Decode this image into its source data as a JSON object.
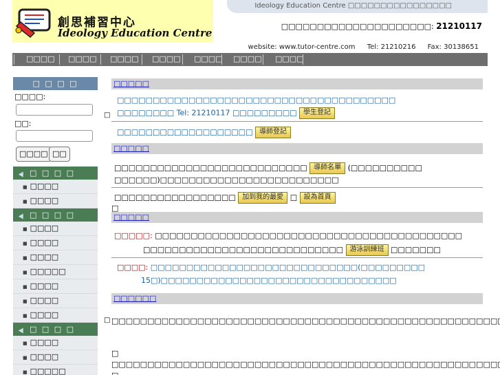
{
  "header": {
    "logo_cn": "創思補習中心",
    "logo_en": "Ideology Education Centre",
    "top_bar": "Ideology Education Centre □□□□□□□□□□□□□□□□",
    "enquiry_label": "□□□□□□□□□□□□□□□□□□□□□:",
    "enquiry_phone": "21210117",
    "website": "website: www.tutor-centre.com",
    "tel": "Tel: 21210216",
    "fax": "Fax: 30138651"
  },
  "nav": {
    "items": [
      "□□□□",
      "□□□□",
      "□□□□",
      "□□□□",
      "□□□□",
      "□□□□",
      "□□□□"
    ]
  },
  "sidebar": {
    "login_title": "□ □ □ □",
    "username_label": "□□□□:",
    "password_label": "□□:",
    "login_button": "□□□□",
    "other_button": "□□",
    "sections": [
      {
        "title": "□ □ □ □",
        "items": [
          "□□□□",
          "□□□□"
        ]
      },
      {
        "title": "□ □ □ □",
        "items": [
          "□□□□",
          "□□□□",
          "□□□□",
          "□□□□□",
          "□□□□",
          "□□□□",
          "□□□□"
        ]
      },
      {
        "title": "□ □ □ □",
        "items": [
          "□□□□",
          "□□□□",
          "□□□□□"
        ]
      }
    ]
  },
  "main": {
    "section1_title": "□□□□□",
    "section1_line1": "□□□□□□□□□□□□□□□□□□□□□□□□□□□□□□□□□□□□□□□",
    "section1_line2": "□□□□□□□□ Tel: 21210117  □□□□□□□□□",
    "btn_student": "學生登記",
    "section1_line3": "□□□□□□□□□□□□□□□□□□□",
    "btn_tutor": "導師登記",
    "section2_title": "□□□□□",
    "section2_line1": "□□□□□□□□□□□□□□□□□□□□□□□□□□□",
    "btn_tutor_list": "導師名單",
    "section2_line1b": "(□□□□□□□□□□",
    "section2_line2": "□□□□□□)□□□□□□□□□□□□□□□□□□□□□□□□□",
    "section2_line3": "□□□□□□□□□□□□□□□□□",
    "btn_favorite": "加到我的最愛",
    "btn_homepage": "設為首頁",
    "section3_title": "□□□□□",
    "section3_label1": "□□□□□:",
    "section3_line1": "□□□□□□□□□□□□□□□□□□□□□□□□□□□□□□□□□□□□□□□□□□□",
    "section3_line2": "□□□□□□□□□□□□□□□□□□□□□□□□□□□□",
    "btn_swim": "游泳訓練班",
    "section3_line2b": "□□□□□□□",
    "section3_label2": "□□□□:",
    "section3_line3": "□□□□□□□□□□□□□□□□□□□□□□□□□□□□□(□□□□□□□□□",
    "section3_line4": "15□)□□□□□□□□□□□□□□□□□□□□□□□□□□□□□□□□□",
    "section4_title": "□□□□□□",
    "para1": "□□□□□□□□□□□□□□□□□□□□□□□□□□□□□□□□□□□□□□□□□□□□□□□□□□□□□□□□□□□□□□□□□□□□□□□□□□□□□□□□□□□□□□□□□□□□□□□□□□□□□□□□□□□□□□□□□□□□□□□□□□□□□□□□□□□□□□□□□□□□□□□□□□□□□□□□□□□□□□□□□□□□□□□□□□□□□□□□□□□□□□□□□□□□□□□□□□",
    "para2": "□",
    "para3": "□□□□□□□□□□□□□□□□□□□□□□□□□□□□□□□□□□□□□□□□□□□□□□□□□□□□□□□□□□□□□□□□□□□□□□□□□□□□□□□□□□□□",
    "para4": "□",
    "stray1": "□",
    "stray2": "□",
    "stray3": "□",
    "stray4": "□"
  }
}
